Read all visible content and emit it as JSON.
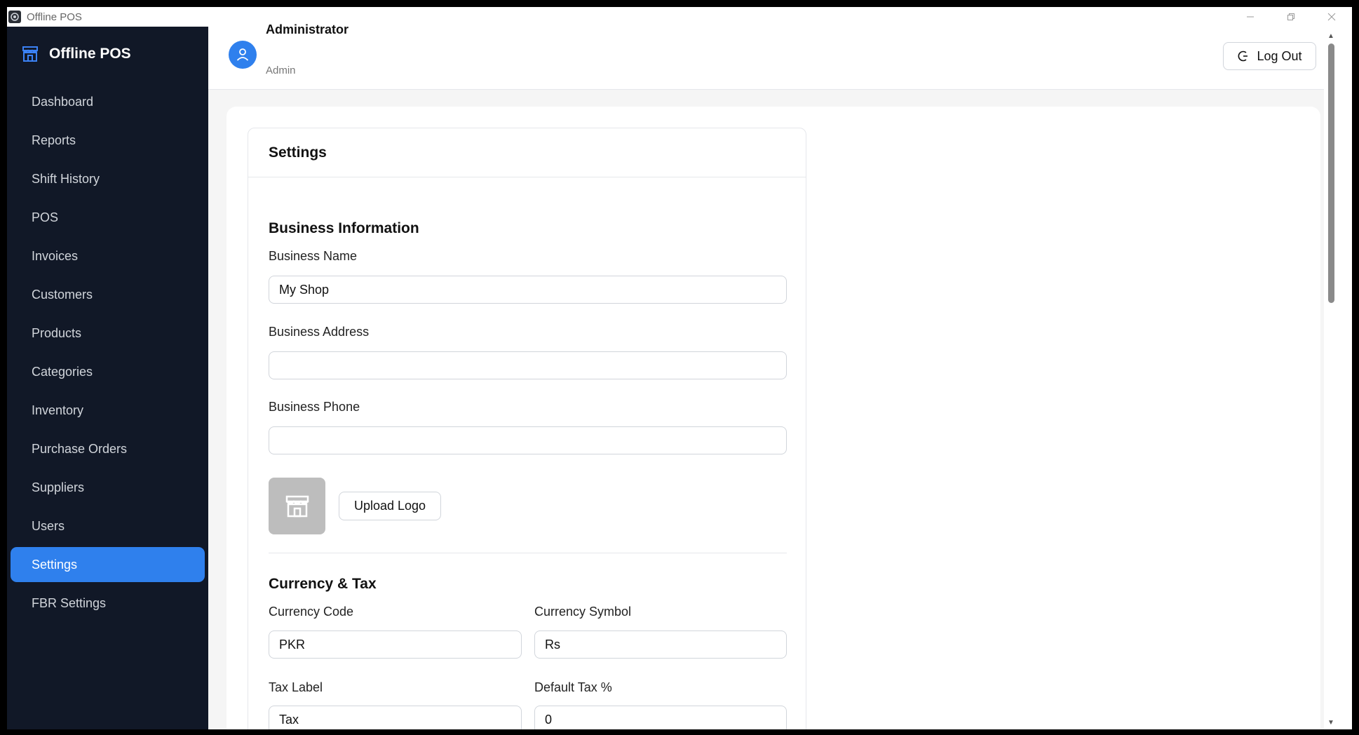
{
  "window": {
    "title": "Offline POS",
    "controls": [
      "minimize",
      "restore",
      "close"
    ]
  },
  "sidebar": {
    "brand": "Offline POS",
    "items": [
      {
        "label": "Dashboard",
        "active": false
      },
      {
        "label": "Reports",
        "active": false
      },
      {
        "label": "Shift History",
        "active": false
      },
      {
        "label": "POS",
        "active": false
      },
      {
        "label": "Invoices",
        "active": false
      },
      {
        "label": "Customers",
        "active": false
      },
      {
        "label": "Products",
        "active": false
      },
      {
        "label": "Categories",
        "active": false
      },
      {
        "label": "Inventory",
        "active": false
      },
      {
        "label": "Purchase Orders",
        "active": false
      },
      {
        "label": "Suppliers",
        "active": false
      },
      {
        "label": "Users",
        "active": false
      },
      {
        "label": "Settings",
        "active": true
      },
      {
        "label": "FBR Settings",
        "active": false
      }
    ]
  },
  "header": {
    "user_name": "Administrator",
    "user_role": "Admin",
    "logout_label": "Log Out"
  },
  "settings": {
    "title": "Settings",
    "business": {
      "section_title": "Business Information",
      "name_label": "Business Name",
      "name_value": "My Shop",
      "address_label": "Business Address",
      "address_value": "",
      "phone_label": "Business Phone",
      "phone_value": "",
      "upload_label": "Upload Logo"
    },
    "currency": {
      "section_title": "Currency & Tax",
      "code_label": "Currency Code",
      "code_value": "PKR",
      "symbol_label": "Currency Symbol",
      "symbol_value": "Rs",
      "tax_label_label": "Tax Label",
      "tax_label_value": "Tax",
      "default_tax_label": "Default Tax %",
      "default_tax_value": "0"
    }
  },
  "colors": {
    "sidebar_bg": "#111827",
    "accent": "#2f80ed",
    "page_bg": "#f5f5f5"
  }
}
